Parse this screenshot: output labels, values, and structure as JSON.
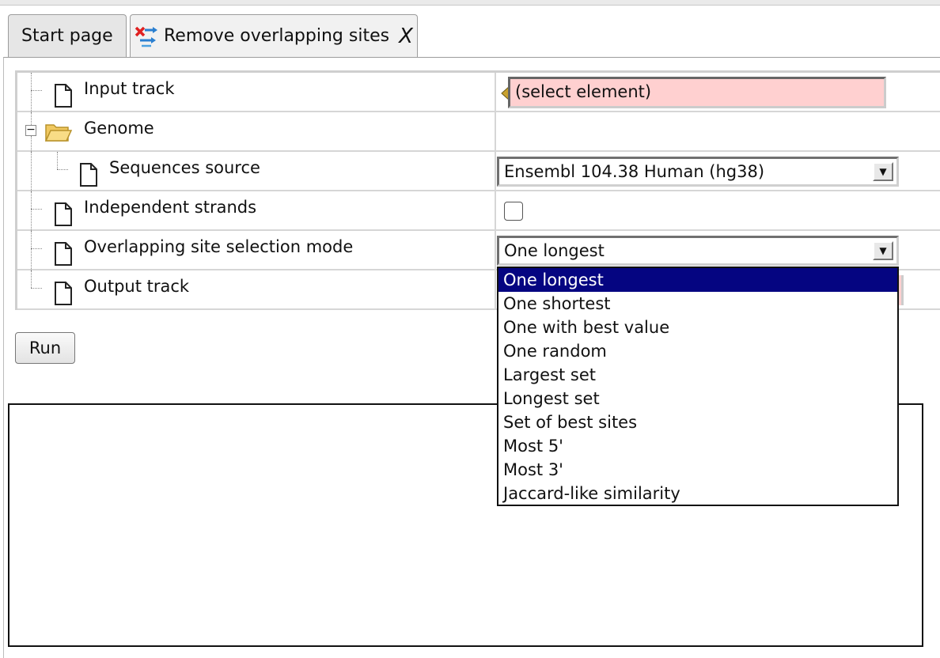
{
  "tabs": {
    "start_label": "Start page",
    "active_label": "Remove overlapping sites",
    "close_label": "X"
  },
  "form": {
    "input_track": {
      "label": "Input track",
      "value": "(select element)"
    },
    "genome": {
      "label": "Genome"
    },
    "sequences_source": {
      "label": "Sequences source",
      "value": "Ensembl 104.38 Human (hg38)"
    },
    "independent_strands": {
      "label": "Independent strands",
      "checked": false
    },
    "selection_mode": {
      "label": "Overlapping site selection mode",
      "value": "One longest",
      "options": [
        "One longest",
        "One shortest",
        "One with best value",
        "One random",
        "Largest set",
        "Longest set",
        "Set of best sites",
        "Most 5'",
        "Most 3'",
        "Jaccard-like similarity"
      ],
      "highlighted": "One longest"
    },
    "output_track": {
      "label": "Output track"
    }
  },
  "run_button": {
    "label": "Run"
  },
  "colors": {
    "required_field_bg": "#ffd0d0",
    "selected_option_bg": "#050581"
  },
  "icons": {
    "tab_icon": "remove-overlap-icon",
    "node_icon": "document-icon",
    "genome_icon": "folder-open-icon",
    "input_select_icon": "arrow-select-icon",
    "combo_button_icon": "chevron-down-icon"
  }
}
